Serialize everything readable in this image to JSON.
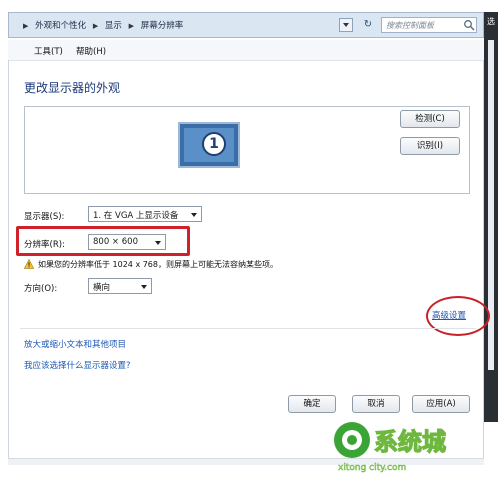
{
  "address_bar": {
    "crumbs": [
      "外观和个性化",
      "显示",
      "屏幕分辨率"
    ],
    "search_placeholder": "搜索控制面板"
  },
  "menubar": {
    "tools": "工具(T)",
    "help": "帮助(H)"
  },
  "side_window": {
    "title": "选"
  },
  "page": {
    "title": "更改显示器的外观",
    "monitor_number": "1",
    "detect_button": "检测(C)",
    "identify_button": "识别(I)",
    "display_label": "显示器(S):",
    "display_value": "1. 在 VGA 上显示设备",
    "resolution_label": "分辨率(R):",
    "resolution_value": "800 × 600",
    "warning_text": "如果您的分辨率低于 1024 x 768，则屏幕上可能无法容纳某些项。",
    "orientation_label": "方向(O):",
    "orientation_value": "横向",
    "advanced_link": "高级设置",
    "link_text_size": "放大或缩小文本和其他项目",
    "link_which_settings": "我应该选择什么显示器设置?"
  },
  "buttons": {
    "ok": "确定",
    "cancel": "取消",
    "apply": "应用(A)"
  },
  "watermark": {
    "brand": "系统城",
    "url": "xitong city.com"
  },
  "colors": {
    "highlight": "#d0202a",
    "link": "#1c59b3",
    "title": "#1a3a78"
  }
}
